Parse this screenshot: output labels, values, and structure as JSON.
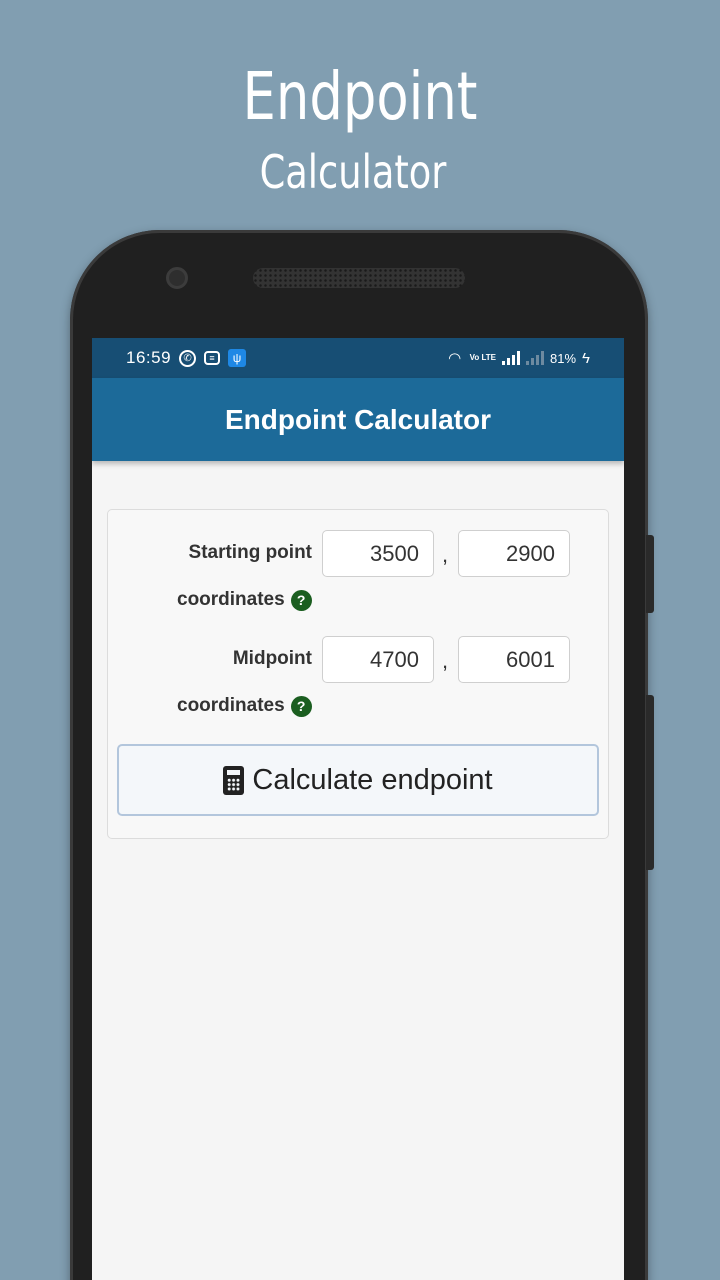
{
  "promo": {
    "title": "Endpoint",
    "subtitle": "Calculator"
  },
  "status_bar": {
    "time": "16:59",
    "battery": "81%",
    "network_label": "Vo LTE"
  },
  "app_bar": {
    "title": "Endpoint Calculator"
  },
  "form": {
    "starting_point": {
      "label_line1": "Starting point",
      "label_line2": "coordinates",
      "x": "3500",
      "y": "2900"
    },
    "midpoint": {
      "label_line1": "Midpoint",
      "label_line2": "coordinates",
      "x": "4700",
      "y": "6001"
    },
    "separator": ",",
    "help_glyph": "?"
  },
  "button": {
    "label": "Calculate endpoint",
    "icon": "calculator-icon"
  },
  "colors": {
    "background": "#819eb1",
    "status_bar": "#174e74",
    "app_bar": "#1c6a99",
    "help_icon": "#1b5e20",
    "button_border": "#b3c6dc"
  }
}
